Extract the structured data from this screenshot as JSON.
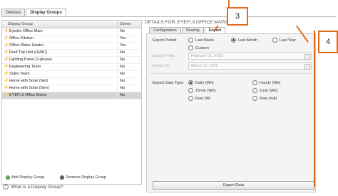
{
  "top_tabs": [
    "Devices",
    "Display Groups"
  ],
  "list": {
    "col_group": "Display Group",
    "col_owner": "Owner",
    "rows": [
      {
        "name": "Eyedro Office Main",
        "owner": "No"
      },
      {
        "name": "Office Kitchen",
        "owner": "Yes"
      },
      {
        "name": "Office Water Heater",
        "owner": "Yes"
      },
      {
        "name": "Roof Top Unit (HVAC)",
        "owner": "No"
      },
      {
        "name": "Lighting Panel (3-phase)",
        "owner": "No"
      },
      {
        "name": "Engineering Team",
        "owner": "No"
      },
      {
        "name": "Sales Team",
        "owner": "No"
      },
      {
        "name": "Home with Solar (Net)",
        "owner": "No"
      },
      {
        "name": "Home with Solar (Gen)",
        "owner": "No"
      },
      {
        "name": "EYEFI.3 Office Mains",
        "owner": "No"
      }
    ],
    "add_label": "Add Display Group",
    "remove_label": "Remove Display Group",
    "whatis": "What is a Display Group?"
  },
  "details": {
    "title": "DETAILS FOR: EYEFI.3 OFFICE MAINS",
    "tabs": [
      "Configuration",
      "Sharing",
      "Export"
    ],
    "export_period_label": "Export Period:",
    "period_options": [
      "Last Week",
      "Last Month",
      "Last Year",
      "Custom"
    ],
    "export_from_label": "Export From:",
    "export_from_value": "February 11, 2020",
    "export_to_label": "Export To:",
    "export_to_value": "March 11, 2020",
    "data_type_label": "Export Data Type:",
    "data_types": [
      "Daily (Wh)",
      "Hourly (Wh)",
      "15min (Wh)",
      "1min (Wh)",
      "Raw (W)",
      "Raw (mA)"
    ],
    "export_button": "Export Data"
  },
  "callouts": [
    "3",
    "4"
  ]
}
